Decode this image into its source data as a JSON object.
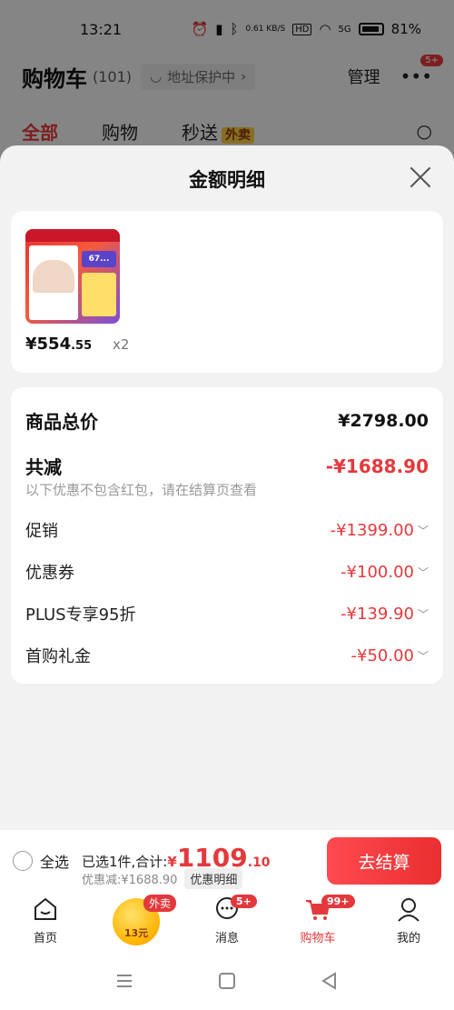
{
  "status_bar": {
    "time": "13:21",
    "network_speed": "0.61 KB/S",
    "hd": "HD",
    "signal": "5G",
    "battery": "81%"
  },
  "cart_header": {
    "title": "购物车",
    "count": "(101)",
    "address_chip": "地址保护中",
    "manage": "管理",
    "more_badge": "5+"
  },
  "tabs": {
    "all": "全部",
    "shopping": "购物",
    "flash": "秒送",
    "waimai": "外卖"
  },
  "sheet": {
    "title": "金额明细",
    "product": {
      "price_int": "¥554",
      "price_dec": ".55",
      "qty": "x2",
      "thumb_price": "67..."
    },
    "rows": {
      "goods_total_label": "商品总价",
      "goods_total_value": "¥2798.00",
      "total_reduction_label": "共减",
      "total_reduction_value": "-¥1688.90",
      "note": "以下优惠不包含红包，请在结算页查看",
      "promo_label": "促销",
      "promo_value": "-¥1399.00",
      "coupon_label": "优惠券",
      "coupon_value": "-¥100.00",
      "plus_label": "PLUS专享95折",
      "plus_value": "-¥139.90",
      "first_label": "首购礼金",
      "first_value": "-¥50.00"
    }
  },
  "checkout": {
    "select_all": "全选",
    "summary_prefix": "已选1件,合计:",
    "currency": "¥",
    "total_int": "1109",
    "total_dec": ".10",
    "discount_text": "优惠减:¥1688.90",
    "detail_chip": "优惠明细",
    "button": "去结算"
  },
  "bottom_nav": {
    "home": "首页",
    "coin_label": "13元",
    "coin_badge": "外卖",
    "messages": "消息",
    "messages_badge": "5+",
    "cart": "购物车",
    "cart_badge": "99+",
    "mine": "我的"
  },
  "colors": {
    "accent_red": "#e4393c",
    "checkout_gradient_start": "#ff4a50",
    "checkout_gradient_end": "#e92f2f"
  }
}
